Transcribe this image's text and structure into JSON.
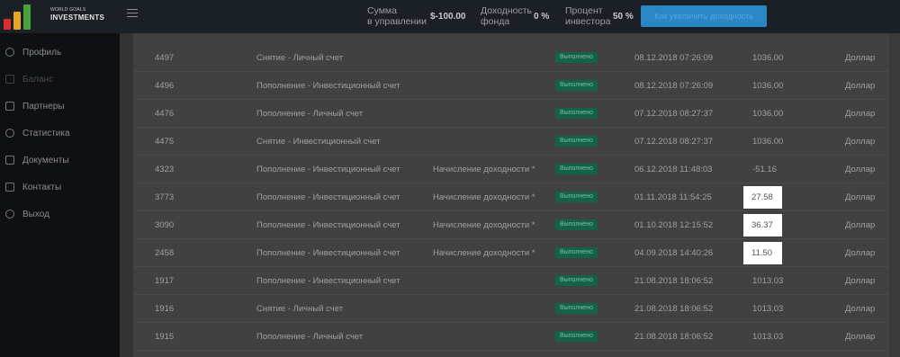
{
  "brand": {
    "line1": "WORLD GOALS",
    "line2": "INVESTMENTS",
    "colors": {
      "bar1": "#d9302c",
      "bar2": "#e8a320",
      "bar3": "#4aa23a"
    }
  },
  "header": {
    "stats": [
      {
        "label_line1": "Сумма",
        "label_line2": "в управлении",
        "value": "$-100.00"
      },
      {
        "label_line1": "Доходность",
        "label_line2": "фонда",
        "value": "0 %"
      },
      {
        "label_line1": "Процент",
        "label_line2": "инвестора",
        "value": "50 %"
      }
    ],
    "action_button": "Как увеличить доходность",
    "accent": "#2a86c4"
  },
  "sidebar": {
    "items": [
      {
        "label": "Профиль",
        "icon": "profile-icon",
        "disabled": false
      },
      {
        "label": "Баланс",
        "icon": "wallet-icon",
        "disabled": true
      },
      {
        "label": "Партнеры",
        "icon": "partners-icon",
        "disabled": false
      },
      {
        "label": "Статистика",
        "icon": "chart-icon",
        "disabled": false
      },
      {
        "label": "Документы",
        "icon": "documents-icon",
        "disabled": false
      },
      {
        "label": "Контакты",
        "icon": "contacts-icon",
        "disabled": false
      },
      {
        "label": "Выход",
        "icon": "logout-icon",
        "disabled": false
      }
    ]
  },
  "table": {
    "status_color": "#14624a",
    "rows": [
      {
        "id": "4497",
        "operation": "Снятие - Личный счет",
        "note": "",
        "status": "Выполнено",
        "date": "08.12.2018 07:26:09",
        "amount": "1036.00",
        "currency": "Доллар",
        "highlight": false
      },
      {
        "id": "4496",
        "operation": "Пополнение - Инвестиционный счет",
        "note": "",
        "status": "Выполнено",
        "date": "08.12.2018 07:26:09",
        "amount": "1036.00",
        "currency": "Доллар",
        "highlight": false
      },
      {
        "id": "4476",
        "operation": "Пополнение - Личный счет",
        "note": "",
        "status": "Выполнено",
        "date": "07.12.2018 08:27:37",
        "amount": "1036.00",
        "currency": "Доллар",
        "highlight": false
      },
      {
        "id": "4475",
        "operation": "Снятие - Инвестиционный счет",
        "note": "",
        "status": "Выполнено",
        "date": "07.12.2018 08:27:37",
        "amount": "1036.00",
        "currency": "Доллар",
        "highlight": false
      },
      {
        "id": "4323",
        "operation": "Пополнение - Инвестиционный счет",
        "note": "Начисление доходности *",
        "status": "Выполнено",
        "date": "06.12.2018 11:48:03",
        "amount": "-51.16",
        "currency": "Доллар",
        "highlight": false
      },
      {
        "id": "3773",
        "operation": "Пополнение - Инвестиционный счет",
        "note": "Начисление доходности *",
        "status": "Выполнено",
        "date": "01.11.2018 11:54:25",
        "amount": "27.58",
        "currency": "Доллар",
        "highlight": true
      },
      {
        "id": "3090",
        "operation": "Пополнение - Инвестиционный счет",
        "note": "Начисление доходности *",
        "status": "Выполнено",
        "date": "01.10.2018 12:15:52",
        "amount": "36.37",
        "currency": "Доллар",
        "highlight": true
      },
      {
        "id": "2458",
        "operation": "Пополнение - Инвестиционный счет",
        "note": "Начисление доходности *",
        "status": "Выполнено",
        "date": "04.09.2018 14:40:26",
        "amount": "11.50",
        "currency": "Доллар",
        "highlight": true
      },
      {
        "id": "1917",
        "operation": "Пополнение - Инвестиционный счет",
        "note": "",
        "status": "Выполнено",
        "date": "21.08.2018 18:06:52",
        "amount": "1013.03",
        "currency": "Доллар",
        "highlight": false
      },
      {
        "id": "1916",
        "operation": "Снятие - Личный счет",
        "note": "",
        "status": "Выполнено",
        "date": "21.08.2018 18:06:52",
        "amount": "1013.03",
        "currency": "Доллар",
        "highlight": false
      },
      {
        "id": "1915",
        "operation": "Пополнение - Личный счет",
        "note": "",
        "status": "Выполнено",
        "date": "21.08.2018 18:06:52",
        "amount": "1013.03",
        "currency": "Доллар",
        "highlight": false
      }
    ]
  }
}
